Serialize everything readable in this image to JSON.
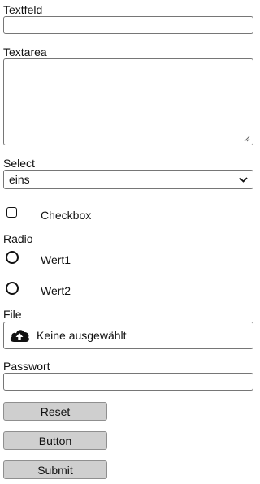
{
  "textfeld": {
    "label": "Textfeld",
    "value": ""
  },
  "textarea": {
    "label": "Textarea",
    "value": ""
  },
  "select": {
    "label": "Select",
    "selected": "eins"
  },
  "checkbox": {
    "label": "Checkbox",
    "checked": false
  },
  "radio": {
    "label": "Radio",
    "options": [
      {
        "label": "Wert1",
        "checked": false
      },
      {
        "label": "Wert2",
        "checked": false
      }
    ]
  },
  "file": {
    "label": "File",
    "status": "Keine ausgewählt",
    "icon": "cloud-upload-icon"
  },
  "passwort": {
    "label": "Passwort",
    "value": ""
  },
  "buttons": {
    "reset": "Reset",
    "button": "Button",
    "submit": "Submit"
  }
}
